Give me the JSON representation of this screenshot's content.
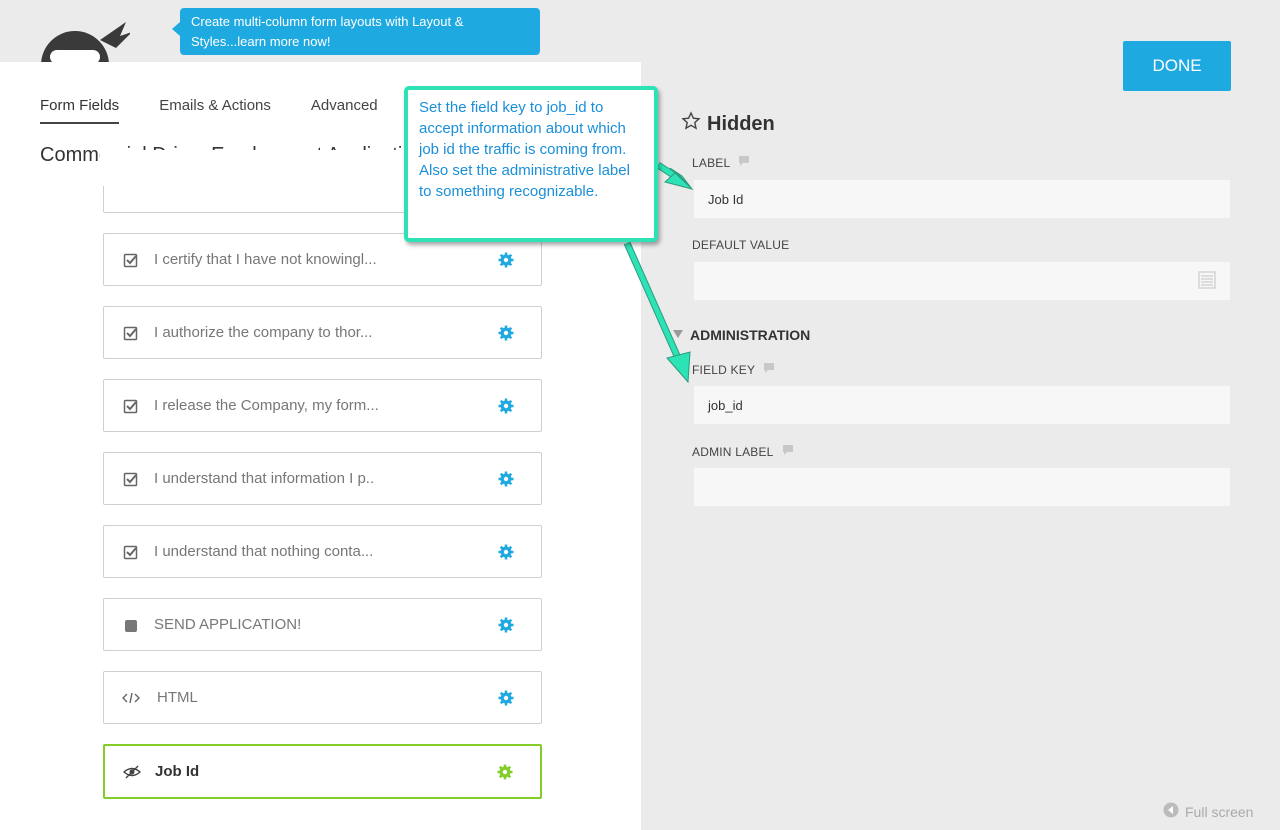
{
  "promo": {
    "text": "Create multi-column form layouts with Layout & Styles...learn more now!"
  },
  "tabs": [
    {
      "label": "Form Fields"
    },
    {
      "label": "Emails & Actions"
    },
    {
      "label": "Advanced"
    }
  ],
  "form": {
    "title": "Commercial Driver Employment Application"
  },
  "fields": [
    {
      "label": "I certify that I have not knowingl...",
      "icon": "checkbox-icon"
    },
    {
      "label": "I authorize the company to thor...",
      "icon": "checkbox-icon"
    },
    {
      "label": "I release the Company, my form...",
      "icon": "checkbox-icon"
    },
    {
      "label": "I understand that information I p..",
      "icon": "checkbox-icon"
    },
    {
      "label": "I understand that nothing conta...",
      "icon": "checkbox-icon"
    },
    {
      "label": "SEND APPLICATION!",
      "icon": "submit-square-icon"
    },
    {
      "label": "HTML",
      "icon": "code-icon"
    },
    {
      "label": "Job Id",
      "icon": "hidden-eye-icon"
    }
  ],
  "toolbar": {
    "done_label": "DONE"
  },
  "settings": {
    "title": "Hidden",
    "label_caption": "LABEL",
    "label_value": "Job Id",
    "default_caption": "DEFAULT VALUE",
    "default_value": "",
    "section_title": "ADMINISTRATION",
    "key_caption": "FIELD KEY",
    "key_value": "job_id",
    "admin_caption": "ADMIN LABEL",
    "admin_value": ""
  },
  "callout": {
    "text": "Set the field key to job_id to accept information about which job id the traffic is coming from.  Also set the administrative label to something recognizable."
  },
  "footer": {
    "fullscreen_label": "Full screen"
  },
  "colors": {
    "accent": "#1ea9e1",
    "selected": "#83cd29",
    "callout_border": "#2de2b4"
  }
}
